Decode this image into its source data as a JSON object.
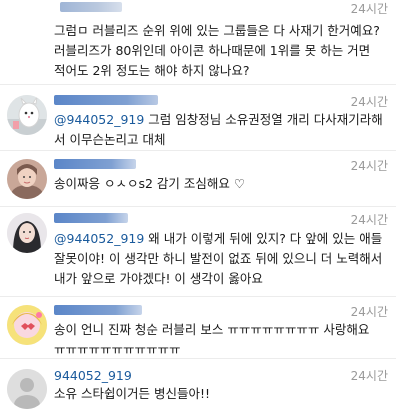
{
  "comments": [
    {
      "time": "24시간",
      "text": "그럼ㅁ 러블리즈 순위 위에 있는 그룹들은 다 사재기 한거예요? 러블리즈가 80위인데 아이콘 하나때문에 1위를 못 하는 거면 적어도 2위 정도는 해야 하지 않나요?"
    },
    {
      "time": "24시간",
      "mention": "@944052_919",
      "text": " 그럼 임창정님 소유권정열 개리 다사재기라해서 이무슨논리고 대체",
      "avatar_icon": "cartoon-character-avatar-icon"
    },
    {
      "time": "24시간",
      "text": "송이짜응 ㅇㅅㅇs2 감기 조심해요 ♡",
      "avatar_icon": "person-photo-avatar-icon"
    },
    {
      "time": "24시간",
      "mention": "@944052_919",
      "text": "  왜 내가 이렇게 뒤에 있지? 다 앞에 있는 애들 잘못이야! 이 생각만 하니 발전이 없죠 뒤에 있으니 더 노력해서 내가 앞으로 가야겠다! 이 생각이 옳아요",
      "avatar_icon": "person-photo-avatar-icon"
    },
    {
      "time": "24시간",
      "text": "송이 언니 진짜 청순 러블리 보스 ㅠㅠㅠㅠㅠㅠㅠㅠ 사랑해요 ㅠㅠㅠㅠㅠㅠㅠㅠㅠㅠㅠ",
      "avatar_icon": "anime-character-avatar-icon"
    },
    {
      "username": "944052_919",
      "time": "24시간",
      "text": "소유 스타쉽이거든 병신들아!!",
      "avatar_icon": "default-profile-avatar-icon"
    }
  ],
  "colors": {
    "username": "#1a5a9c",
    "timestamp": "#9a9a9a",
    "blurred_username": "#5b86c8"
  }
}
